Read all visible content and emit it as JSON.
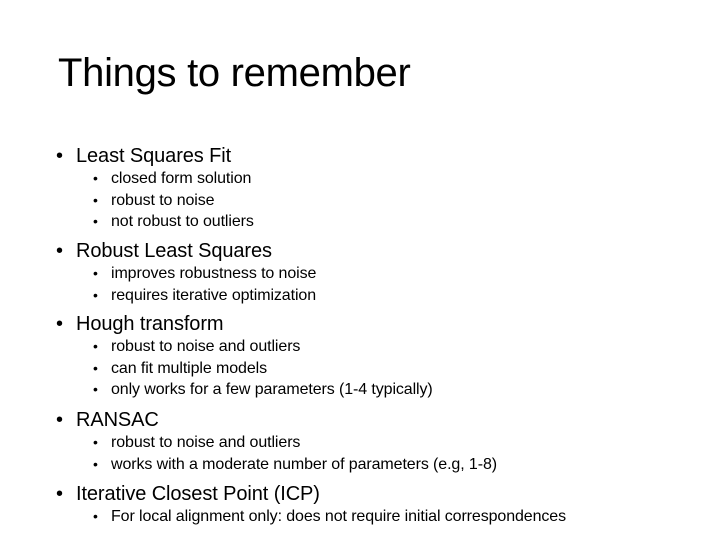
{
  "slide": {
    "title": "Things to remember",
    "bullet_glyph": "•",
    "sections": [
      {
        "heading": "Least Squares Fit",
        "items": [
          "closed form solution",
          "robust to noise",
          "not robust to outliers"
        ]
      },
      {
        "heading": "Robust Least Squares",
        "items": [
          "improves robustness to noise",
          "requires iterative optimization"
        ]
      },
      {
        "heading": "Hough transform",
        "items": [
          "robust to noise and outliers",
          "can fit multiple models",
          "only works for a few parameters (1-4 typically)"
        ]
      },
      {
        "heading": "RANSAC",
        "items": [
          "robust to noise and outliers",
          "works with a moderate number of parameters (e.g, 1-8)"
        ]
      },
      {
        "heading": "Iterative Closest Point (ICP)",
        "items": [
          "For local alignment only: does not require initial correspondences"
        ]
      }
    ]
  }
}
